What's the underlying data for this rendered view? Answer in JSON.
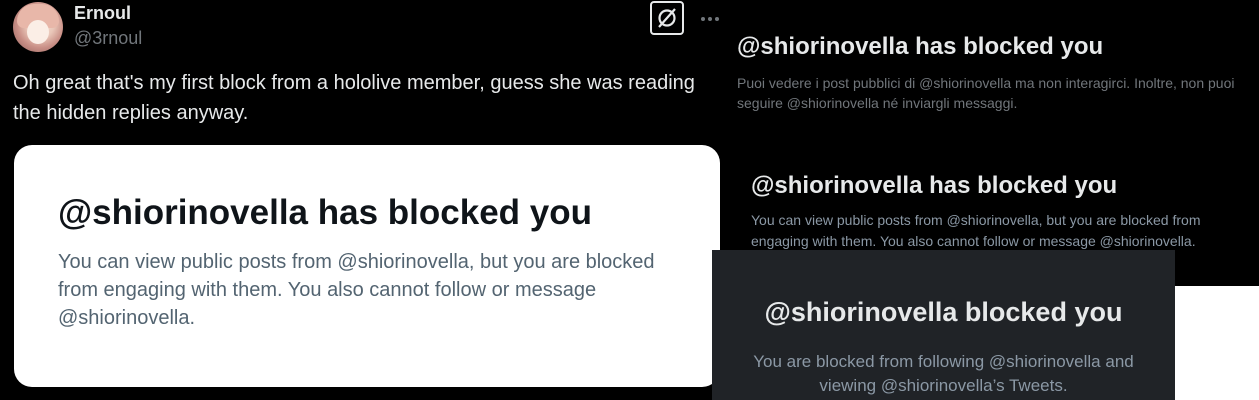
{
  "tweet": {
    "display_name": "Ernoul",
    "handle": "@3rnoul",
    "text": "Oh great that's my first block from a hololive member, guess she was reading the hidden replies anyway.",
    "more_icon": "more-horizontal-icon",
    "grok_icon": "grok-icon"
  },
  "card_light": {
    "title": "@shiorinovella has blocked you",
    "body": "You can view public posts from @shiorinovella, but you are blocked from engaging with them. You also cannot follow or message @shiorinovella."
  },
  "card_italian": {
    "title": "@shiorinovella has blocked you",
    "body": "Puoi vedere i post pubblici di @shiorinovella ma non interagirci. Inoltre, non puoi seguire @shiorinovella né inviargli messaggi."
  },
  "card_dark": {
    "title": "@shiorinovella has blocked you",
    "body": "You can view public posts from @shiorinovella, but you are blocked from engaging with them. You also cannot follow or message @shiorinovella."
  },
  "card_old": {
    "title": "@shiorinovella blocked you",
    "body": "You are blocked from following @shiorinovella and viewing @shiorinovella’s Tweets."
  }
}
